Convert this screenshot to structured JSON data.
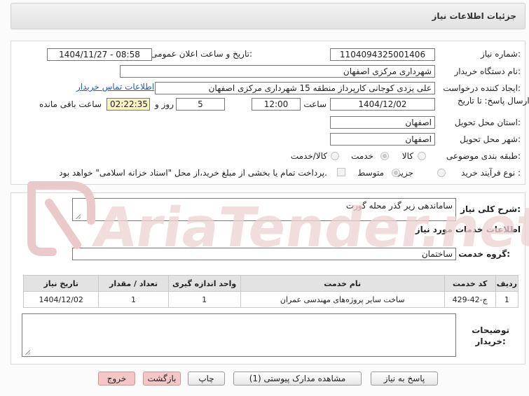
{
  "page_title": "جزئیات اطلاعات نیاز",
  "fields": {
    "need_number": {
      "label": "شماره نیاز:",
      "value": "1104094325001406"
    },
    "announce_datetime": {
      "label": "تاریخ و ساعت اعلان عمومی:",
      "value": "1404/11/27 - 08:58"
    },
    "buyer_org": {
      "label": "نام دستگاه خریدار:",
      "value": "شهرداری مرکزی اصفهان"
    },
    "requester": {
      "label": "ایجاد کننده درخواست:",
      "value": "علی یزدی کوجانی کارپرداز منطقه 15 شهرداری مرکزی اصفهان"
    },
    "contact_link": "اطلاعات تماس خریدار",
    "deadline": {
      "label": "مهلت ارسال پاسخ: تا تاریخ:",
      "date": "1404/12/02",
      "time_label": "ساعت",
      "time": "12:00",
      "days": "5",
      "days_label": "روز و",
      "remaining": "02:22:35",
      "remaining_label": "ساعت باقی مانده"
    },
    "province": {
      "label": "استان محل تحویل:",
      "value": "اصفهان"
    },
    "city": {
      "label": "شهر محل تحویل:",
      "value": "اصفهان"
    },
    "category": {
      "label": "طبقه بندی موضوعی:",
      "options": [
        {
          "label": "کالا",
          "selected": false
        },
        {
          "label": "خدمت",
          "selected": true
        },
        {
          "label": "کالا/خدمت",
          "selected": false
        }
      ]
    },
    "process_type": {
      "label": "نوع فرآیند خرید :",
      "options": [
        {
          "label": "جزیی",
          "selected": false
        },
        {
          "label": "متوسط",
          "selected": true
        }
      ],
      "payment_note": "پرداخت تمام یا بخشی از مبلغ خرید،از محل \"اسناد خزانه اسلامی\" خواهد بود."
    }
  },
  "description": {
    "label": "شرح کلی نیاز:",
    "value": "ساماندهی زیر گذر محله گورت"
  },
  "services_header": "اطلاعات خدمات مورد نیاز",
  "service_group": {
    "label": "گروه خدمت:",
    "value": "ساختمان"
  },
  "table": {
    "columns": [
      "ردیف",
      "کد خدمت",
      "نام خدمت",
      "واحد اندازه گیری",
      "تعداد / مقدار",
      "تاریخ نیاز"
    ],
    "rows": [
      [
        "1",
        "ج-42-429",
        "ساخت سایر پروژه‌های مهندسی عمران",
        "1",
        "1",
        "1404/12/02"
      ]
    ]
  },
  "buyer_notes": {
    "label_line1": "توضیحات",
    "label_line2": "خریدار:",
    "value": ""
  },
  "buttons": {
    "reply": "پاسخ به نیاز",
    "attachments": "مشاهده مدارک پیوستی (1)",
    "print": "چاپ",
    "back": "بازگشت",
    "exit": "خروج"
  },
  "watermark": "AriaTender.net",
  "colors": {
    "link": "#1a5fb4",
    "yellow_box": "#fbf2c4",
    "pink_button": "#f6c6c6",
    "watermark": "#e7c5c5"
  }
}
